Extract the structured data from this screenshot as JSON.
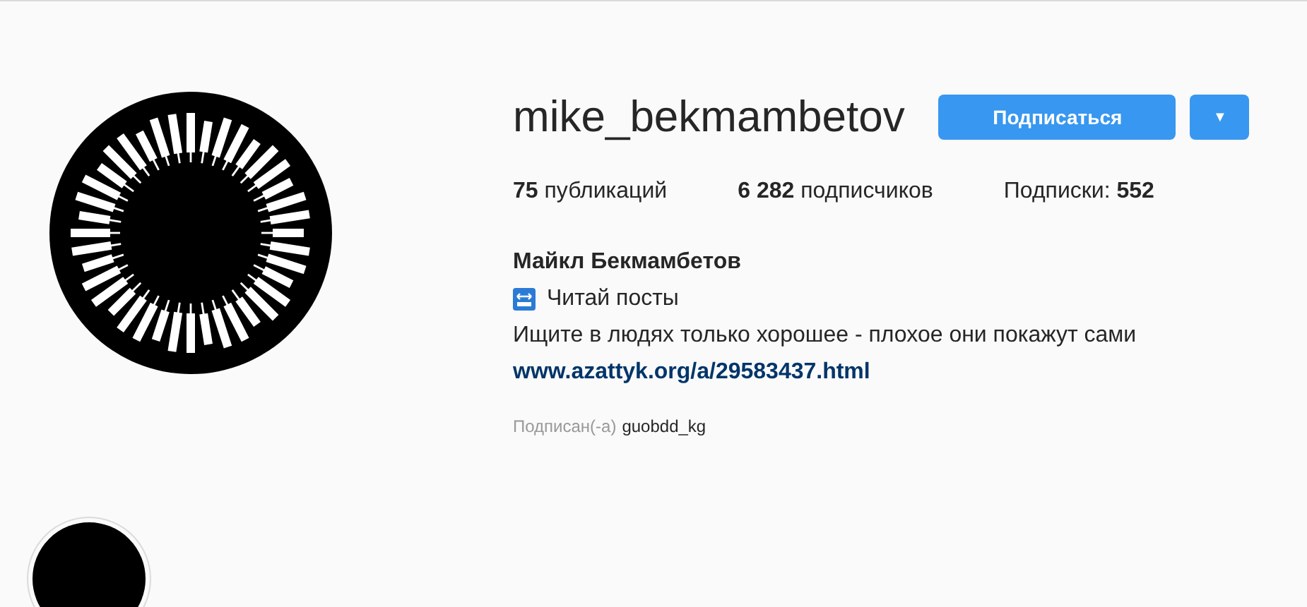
{
  "profile": {
    "username": "mike_bekmambetov",
    "follow_button": "Подписаться",
    "dropdown_button": "▼",
    "stats": [
      "**75** публикаций",
      "**6 282** подписчиков",
      "Подписки: **552**"
    ],
    "full_name": "Майкл Бекмамбетов",
    "bio_lines": [
      {
        "kind": "icon",
        "text": "Читай посты"
      },
      {
        "kind": "plain",
        "text": "Ищите в людях только хорошее - плохое они покажут сами"
      }
    ],
    "link": "www.azattyk.org/a/29583437.html",
    "followed_by": {
      "label": "Подписан(-а)",
      "user": "guobdd_kg"
    }
  }
}
